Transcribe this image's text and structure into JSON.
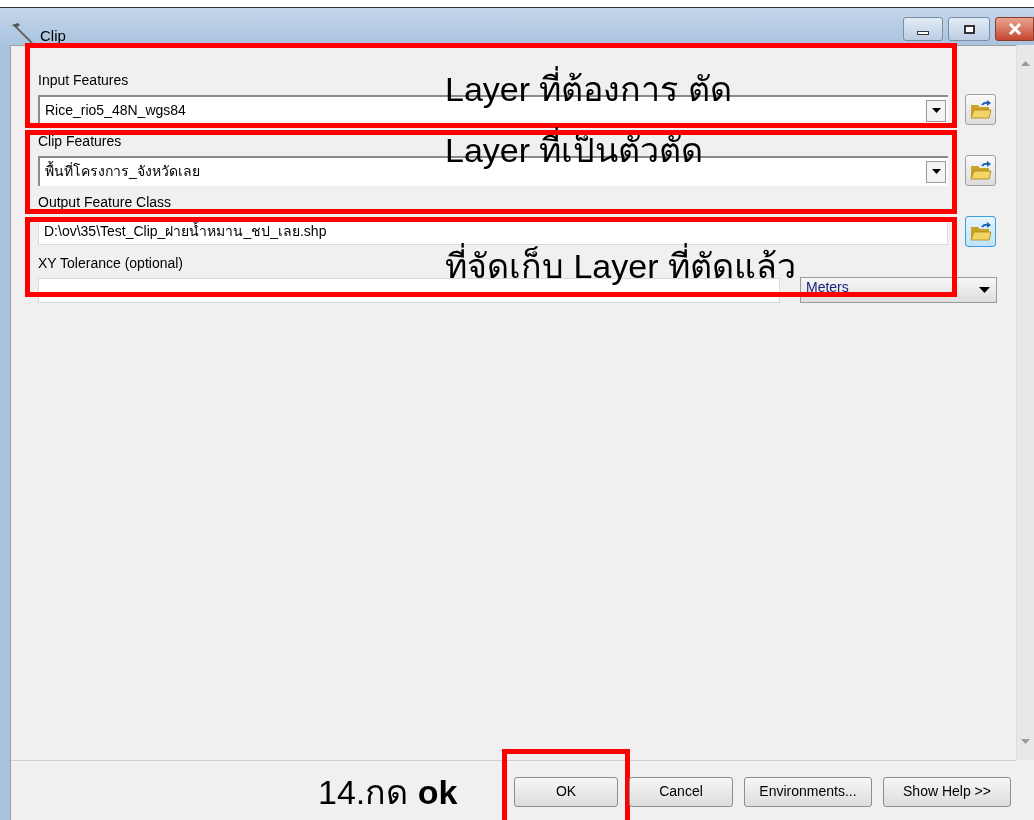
{
  "window": {
    "title": "Clip"
  },
  "fields": [
    {
      "kind": "dropdown",
      "label": "Input Features",
      "value": "Rice_rio5_48N_wgs84",
      "browse_focused": false
    },
    {
      "kind": "dropdown",
      "label": "Clip Features",
      "value": "พื้นที่โครงการ_จังหวัดเลย",
      "browse_focused": false
    },
    {
      "kind": "text",
      "label": "Output Feature Class",
      "value": "D:\\ov\\35\\Test_Clip_ฝายน้ำหมาน_ชป_เลย.shp",
      "browse_focused": true
    },
    {
      "kind": "units",
      "label": "XY Tolerance (optional)",
      "units": "Meters"
    }
  ],
  "annotations": [
    {
      "text": "Layer ที่ต้องการ ตัด"
    },
    {
      "text": "Layer ที่เป็นตัวตัด"
    },
    {
      "text": "ที่จัดเก็บ Layer ที่ตัดแล้ว"
    }
  ],
  "step_note": "14.กด **ok**",
  "buttons": [
    {
      "label": "OK",
      "highlighted": true
    },
    {
      "label": "Cancel",
      "highlighted": false
    },
    {
      "label": "Environments...",
      "highlighted": false
    },
    {
      "label": "Show Help >>",
      "highlighted": false
    }
  ]
}
